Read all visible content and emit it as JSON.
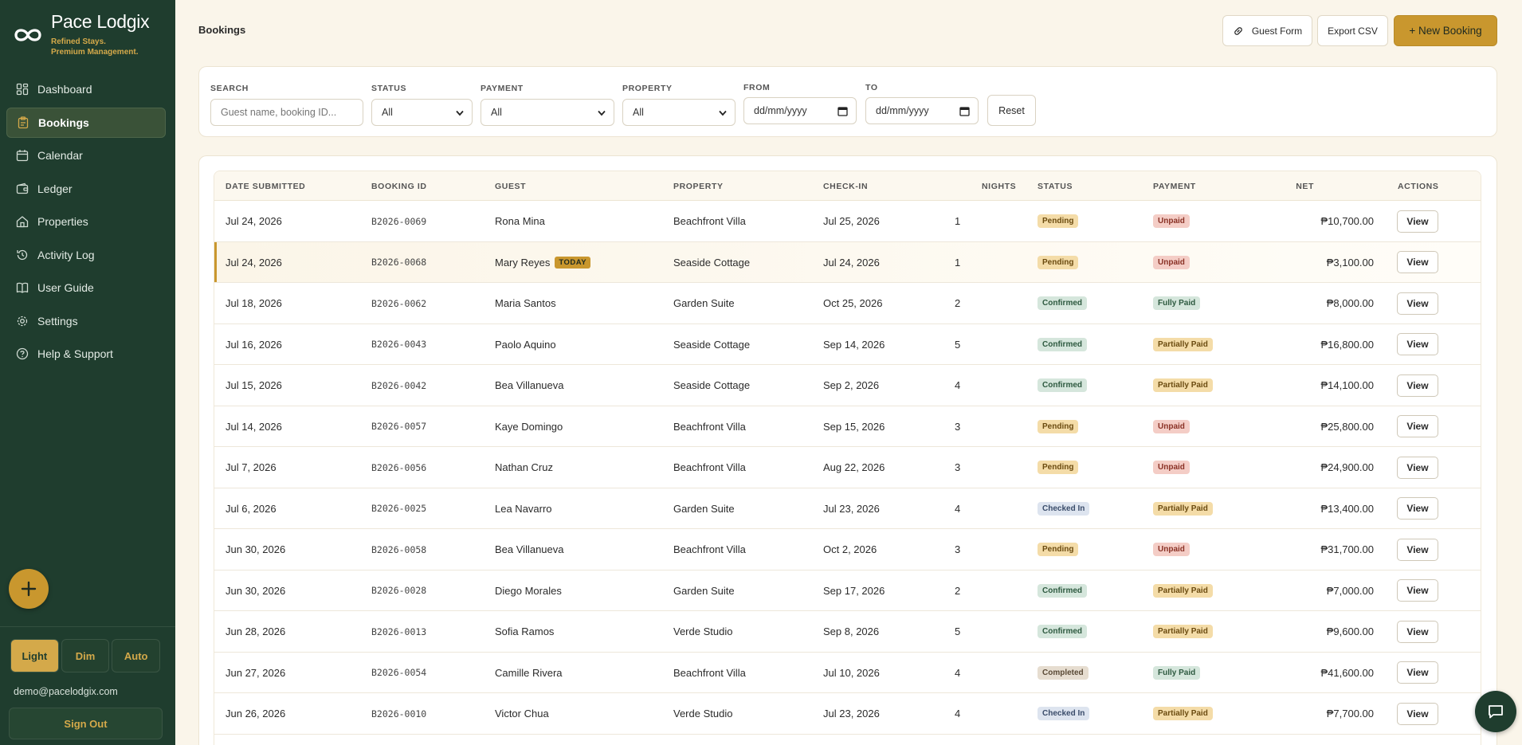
{
  "brand": {
    "name": "Pace Lodgix",
    "tagline_1": "Refined Stays.",
    "tagline_2": "Premium Management.",
    "accent_color": "#d4a94a",
    "sidebar_color": "#1f3d2e"
  },
  "nav": [
    {
      "label": "Dashboard",
      "icon": "dashboard-icon"
    },
    {
      "label": "Bookings",
      "icon": "clipboard-icon",
      "active": true
    },
    {
      "label": "Calendar",
      "icon": "calendar-icon"
    },
    {
      "label": "Ledger",
      "icon": "wallet-icon"
    },
    {
      "label": "Properties",
      "icon": "home-icon"
    },
    {
      "label": "Activity Log",
      "icon": "history-icon"
    },
    {
      "label": "User Guide",
      "icon": "book-icon"
    },
    {
      "label": "Settings",
      "icon": "gear-icon"
    },
    {
      "label": "Help & Support",
      "icon": "help-icon"
    }
  ],
  "theme": {
    "light": "Light",
    "dim": "Dim",
    "auto": "Auto",
    "selected": "Light"
  },
  "user": {
    "email": "demo@pacelodgix.com",
    "sign_out": "Sign Out"
  },
  "header": {
    "title": "Bookings",
    "guest_form": "Guest Form",
    "export_csv": "Export CSV",
    "new_booking": "+ New Booking"
  },
  "filters": {
    "search_label": "SEARCH",
    "search_placeholder": "Guest name, booking ID...",
    "status_label": "STATUS",
    "status_value": "All",
    "payment_label": "PAYMENT",
    "payment_value": "All",
    "property_label": "PROPERTY",
    "property_value": "All",
    "from_label": "FROM",
    "from_value": "dd/mm/yyyy",
    "to_label": "TO",
    "to_value": "dd/mm/yyyy",
    "reset": "Reset"
  },
  "table": {
    "columns": {
      "date_submitted": "DATE SUBMITTED",
      "booking_id": "BOOKING ID",
      "guest": "GUEST",
      "property": "PROPERTY",
      "check_in": "CHECK-IN",
      "nights": "NIGHTS",
      "status": "STATUS",
      "payment": "PAYMENT",
      "net": "NET",
      "actions": "ACTIONS"
    },
    "today_label": "TODAY",
    "view_label": "View",
    "rows": [
      {
        "date": "Jul 24, 2026",
        "id": "B2026-0069",
        "guest": "Rona Mina",
        "property": "Beachfront Villa",
        "checkin": "Jul 25, 2026",
        "nights": "1",
        "status": "Pending",
        "payment": "Unpaid",
        "net": "₱10,700.00"
      },
      {
        "date": "Jul 24, 2026",
        "id": "B2026-0068",
        "guest": "Mary Reyes",
        "today": true,
        "property": "Seaside Cottage",
        "checkin": "Jul 24, 2026",
        "nights": "1",
        "status": "Pending",
        "payment": "Unpaid",
        "net": "₱3,100.00"
      },
      {
        "date": "Jul 18, 2026",
        "id": "B2026-0062",
        "guest": "Maria Santos",
        "property": "Garden Suite",
        "checkin": "Oct 25, 2026",
        "nights": "2",
        "status": "Confirmed",
        "payment": "Fully Paid",
        "net": "₱8,000.00"
      },
      {
        "date": "Jul 16, 2026",
        "id": "B2026-0043",
        "guest": "Paolo Aquino",
        "property": "Seaside Cottage",
        "checkin": "Sep 14, 2026",
        "nights": "5",
        "status": "Confirmed",
        "payment": "Partially Paid",
        "net": "₱16,800.00"
      },
      {
        "date": "Jul 15, 2026",
        "id": "B2026-0042",
        "guest": "Bea Villanueva",
        "property": "Seaside Cottage",
        "checkin": "Sep 2, 2026",
        "nights": "4",
        "status": "Confirmed",
        "payment": "Partially Paid",
        "net": "₱14,100.00"
      },
      {
        "date": "Jul 14, 2026",
        "id": "B2026-0057",
        "guest": "Kaye Domingo",
        "property": "Beachfront Villa",
        "checkin": "Sep 15, 2026",
        "nights": "3",
        "status": "Pending",
        "payment": "Unpaid",
        "net": "₱25,800.00"
      },
      {
        "date": "Jul 7, 2026",
        "id": "B2026-0056",
        "guest": "Nathan Cruz",
        "property": "Beachfront Villa",
        "checkin": "Aug 22, 2026",
        "nights": "3",
        "status": "Pending",
        "payment": "Unpaid",
        "net": "₱24,900.00"
      },
      {
        "date": "Jul 6, 2026",
        "id": "B2026-0025",
        "guest": "Lea Navarro",
        "property": "Garden Suite",
        "checkin": "Jul 23, 2026",
        "nights": "4",
        "status": "Checked In",
        "payment": "Partially Paid",
        "net": "₱13,400.00"
      },
      {
        "date": "Jun 30, 2026",
        "id": "B2026-0058",
        "guest": "Bea Villanueva",
        "property": "Beachfront Villa",
        "checkin": "Oct 2, 2026",
        "nights": "3",
        "status": "Pending",
        "payment": "Unpaid",
        "net": "₱31,700.00"
      },
      {
        "date": "Jun 30, 2026",
        "id": "B2026-0028",
        "guest": "Diego Morales",
        "property": "Garden Suite",
        "checkin": "Sep 17, 2026",
        "nights": "2",
        "status": "Confirmed",
        "payment": "Partially Paid",
        "net": "₱7,000.00"
      },
      {
        "date": "Jun 28, 2026",
        "id": "B2026-0013",
        "guest": "Sofia Ramos",
        "property": "Verde Studio",
        "checkin": "Sep 8, 2026",
        "nights": "5",
        "status": "Confirmed",
        "payment": "Partially Paid",
        "net": "₱9,600.00"
      },
      {
        "date": "Jun 27, 2026",
        "id": "B2026-0054",
        "guest": "Camille Rivera",
        "property": "Beachfront Villa",
        "checkin": "Jul 10, 2026",
        "nights": "4",
        "status": "Completed",
        "payment": "Fully Paid",
        "net": "₱41,600.00"
      },
      {
        "date": "Jun 26, 2026",
        "id": "B2026-0010",
        "guest": "Victor Chua",
        "property": "Verde Studio",
        "checkin": "Jul 23, 2026",
        "nights": "4",
        "status": "Checked In",
        "payment": "Partially Paid",
        "net": "₱7,700.00"
      }
    ]
  }
}
